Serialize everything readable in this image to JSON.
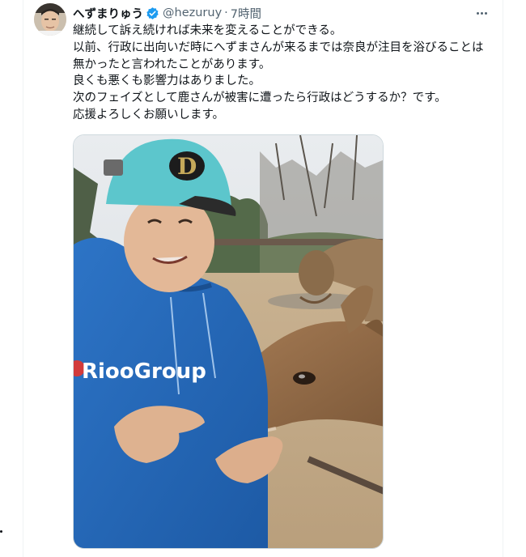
{
  "author": {
    "display_name": "へずまりゅう",
    "handle": "@hezuruy",
    "separator": "·",
    "time": "7時間",
    "verified_icon": "verified-badge-icon",
    "verified_color": "#1d9bf0"
  },
  "tweet": {
    "lines": [
      "継続して訴え続ければ未来を変えることができる。",
      "以前、行政に出向いだ時にへずまさんが来るまでは奈良が注目を浴びることは無かったと言われたことがあります。",
      "良くも悪くも影響力はありました。",
      "次のフェイズとして鹿さんが被害に遭ったら行政はどうするか？です。",
      "応援よろしくお願いします。"
    ]
  },
  "photo": {
    "hoodie_text": "RiooGroup",
    "cap_logo": "D"
  },
  "icons": {
    "more": "more-horizontal-icon"
  },
  "colors": {
    "text": "#0f1419",
    "secondary": "#536471",
    "border": "#cfd9de"
  }
}
